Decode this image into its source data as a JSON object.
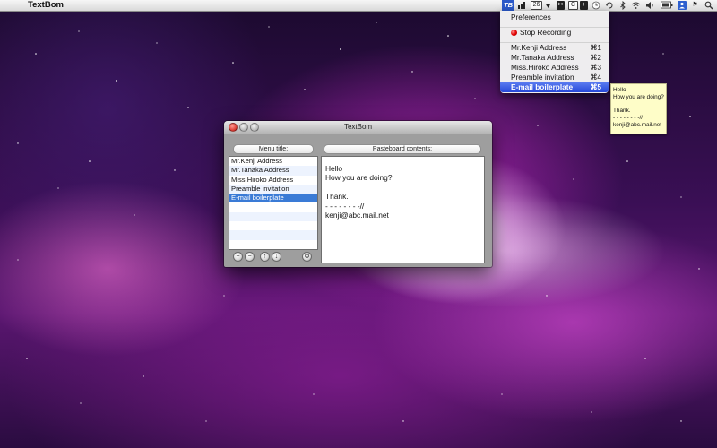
{
  "menubar": {
    "app_name": "TextBom",
    "tb_icon_label": "TB",
    "badge_26": "26"
  },
  "dropdown": {
    "preferences": "Preferences",
    "stop_recording": "Stop Recording",
    "items": [
      {
        "label": "Mr.Kenji Address",
        "key": "⌘1"
      },
      {
        "label": "Mr.Tanaka Address",
        "key": "⌘2"
      },
      {
        "label": "Miss.Hiroko Address",
        "key": "⌘3"
      },
      {
        "label": "Preamble invitation",
        "key": "⌘4"
      },
      {
        "label": "E-mail boilerplate",
        "key": "⌘5"
      }
    ]
  },
  "tooltip": {
    "lines": [
      "Hello",
      "How you are doing?",
      "",
      "Thank.",
      "- - - - - - - -//",
      "kenji@abc.mail.net"
    ]
  },
  "window": {
    "title": "TextBom",
    "menu_title_label": "Menu title:",
    "pasteboard_label": "Pasteboard contents:",
    "list": [
      "Mr.Kenji Address",
      "Mr.Tanaka Address",
      "Miss.Hiroko Address",
      "Preamble invitation",
      "E-mail boilerplate"
    ],
    "content_lines": [
      "Hello",
      "How you are doing?",
      "",
      "Thank.",
      "- - - - - - - -//",
      "kenji@abc.mail.net"
    ],
    "buttons": {
      "add": "+",
      "remove": "−",
      "up": "↑",
      "down": "↓",
      "action": "⚙"
    }
  }
}
